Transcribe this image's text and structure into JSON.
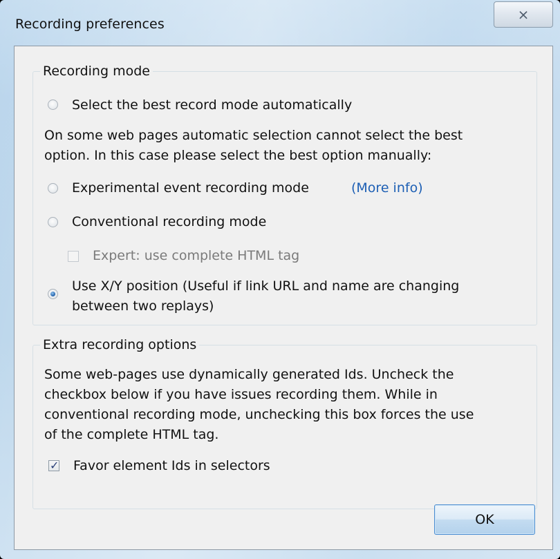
{
  "window": {
    "title": "Recording preferences",
    "close_label": "⨯"
  },
  "recording_mode": {
    "legend": "Recording mode",
    "auto_option": "Select the best record mode automatically",
    "note_line1": "On some web pages automatic selection cannot select the best",
    "note_line2": "option. In this case please select the best option manually:",
    "experimental_option": "Experimental event recording mode",
    "more_info_link": "(More info)",
    "conventional_option": "Conventional recording mode",
    "expert_checkbox_label": "Expert: use complete HTML tag",
    "xy_option_line1": "Use X/Y position (Useful if link URL and name are changing",
    "xy_option_line2": "between two replays)",
    "selected": "xy_position"
  },
  "extra_options": {
    "legend": "Extra recording options",
    "desc_line1": "Some web-pages use dynamically generated Ids. Uncheck the",
    "desc_line2": "checkbox below if you have issues recording them. While in",
    "desc_line3": "conventional recording mode, unchecking this box forces the use",
    "desc_line4": "of the complete HTML tag.",
    "favor_ids_label": "Favor element Ids in selectors",
    "favor_ids_checked": true,
    "check_mark": "✓"
  },
  "buttons": {
    "ok_label": "OK"
  },
  "colors": {
    "link": "#1d5fb4",
    "accent": "#4a8cd0"
  }
}
